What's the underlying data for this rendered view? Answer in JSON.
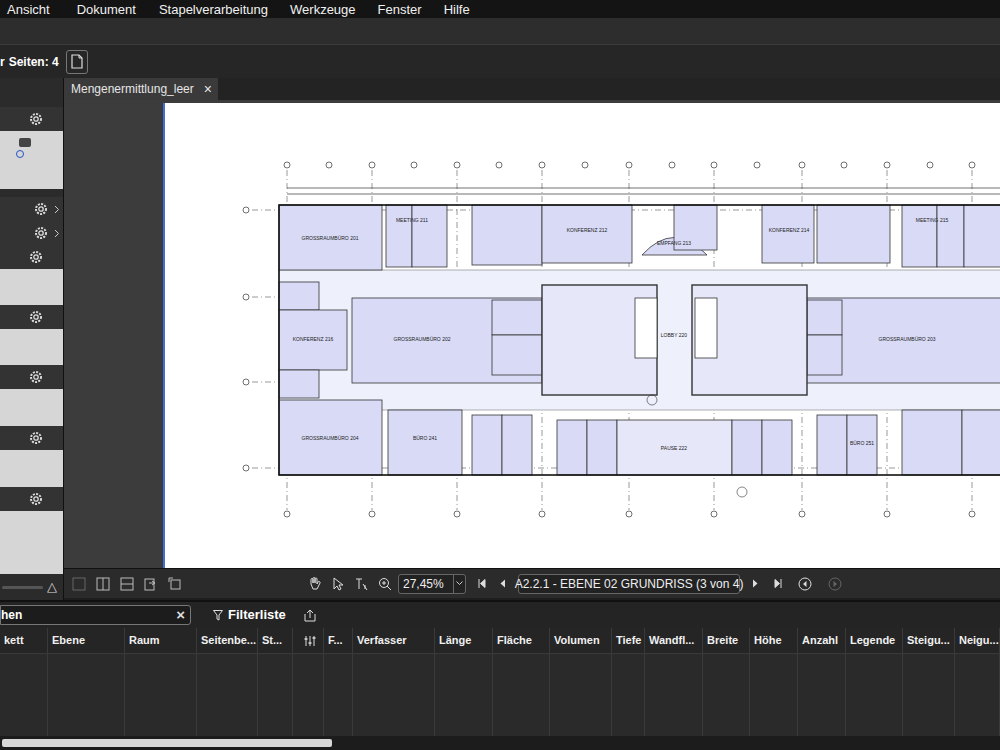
{
  "menu": [
    "Ansicht",
    "Dokument",
    "Stapelverarbeitung",
    "Werkzeuge",
    "Fenster",
    "Hilfe"
  ],
  "toolbar": {
    "cut_label": "r",
    "pages_label": "Seiten: 4"
  },
  "document_tab": {
    "label": "Mengenermittlung_leer",
    "close": "×"
  },
  "side_panel": {
    "collapse": "△"
  },
  "plan": {
    "rooms": [
      "GROSSRAUMBÜRO 201",
      "MEETING 211",
      "KONFERENZ 212",
      "EMPFANG 213",
      "KONFERENZ 214",
      "MEETING 215",
      "GROSSRAUMBÜRO 202",
      "LOBBY 220",
      "GROSSRAUMBÜRO 203",
      "KONFERENZ 216",
      "GROSSRAUMBÜRO 204",
      "BÜRO 241",
      "PAUSE 222",
      "BÜRO 251"
    ]
  },
  "navigation": {
    "zoom": "27,45%",
    "page": "A2.2.1 - EBENE 02 GRUNDRISS (3 von 4)"
  },
  "markups_list": {
    "search_value": "hen",
    "clear": "×",
    "filter_label": "Filterliste",
    "columns": [
      {
        "kind": "text",
        "label": "kett"
      },
      {
        "kind": "text",
        "label": "Ebene"
      },
      {
        "kind": "text",
        "label": "Raum"
      },
      {
        "kind": "text",
        "label": "Seitenbe..."
      },
      {
        "kind": "text",
        "label": "St..."
      },
      {
        "kind": "icon"
      },
      {
        "kind": "text",
        "label": "F..."
      },
      {
        "kind": "text",
        "label": "Verfasser"
      },
      {
        "kind": "text",
        "label": "Länge"
      },
      {
        "kind": "text",
        "label": "Fläche"
      },
      {
        "kind": "text",
        "label": "Volumen"
      },
      {
        "kind": "text",
        "label": "Tiefe"
      },
      {
        "kind": "text",
        "label": "Wandfl..."
      },
      {
        "kind": "text",
        "label": "Breite"
      },
      {
        "kind": "text",
        "label": "Höhe"
      },
      {
        "kind": "text",
        "label": "Anzahl"
      },
      {
        "kind": "text",
        "label": "Legende"
      },
      {
        "kind": "text",
        "label": "Steigu..."
      },
      {
        "kind": "text",
        "label": "Neigu..."
      }
    ]
  }
}
